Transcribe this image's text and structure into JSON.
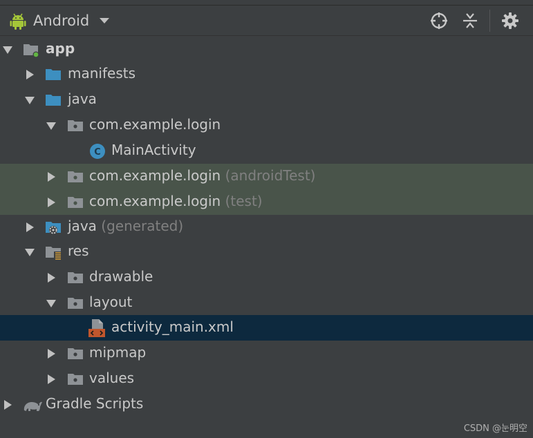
{
  "toolbar": {
    "view_label": "Android",
    "buttons": [
      {
        "name": "locate-icon"
      },
      {
        "name": "collapse-all-icon"
      },
      {
        "name": "gear-icon"
      }
    ]
  },
  "tree": {
    "rows": [
      {
        "text": "app",
        "extra": "",
        "bold": true,
        "expanded": true,
        "icon": "module-folder-icon"
      },
      {
        "text": "manifests",
        "extra": "",
        "expanded": false,
        "icon": "folder-icon"
      },
      {
        "text": "java",
        "extra": "",
        "expanded": true,
        "icon": "folder-icon"
      },
      {
        "text": "com.example.login",
        "extra": "",
        "expanded": true,
        "icon": "package-icon"
      },
      {
        "text": "MainActivity",
        "extra": "",
        "icon": "class-icon"
      },
      {
        "text": "com.example.login",
        "extra": "(androidTest)",
        "expanded": false,
        "icon": "package-icon"
      },
      {
        "text": "com.example.login",
        "extra": "(test)",
        "expanded": false,
        "icon": "package-icon"
      },
      {
        "text": "java",
        "extra": "(generated)",
        "expanded": false,
        "icon": "generated-folder-icon"
      },
      {
        "text": "res",
        "extra": "",
        "expanded": true,
        "icon": "resources-folder-icon"
      },
      {
        "text": "drawable",
        "extra": "",
        "expanded": false,
        "icon": "package-icon"
      },
      {
        "text": "layout",
        "extra": "",
        "expanded": true,
        "icon": "package-icon"
      },
      {
        "text": "activity_main.xml",
        "extra": "",
        "icon": "layout-xml-icon"
      },
      {
        "text": "mipmap",
        "extra": "",
        "expanded": false,
        "icon": "package-icon"
      },
      {
        "text": "values",
        "extra": "",
        "expanded": false,
        "icon": "package-icon"
      },
      {
        "text": "Gradle Scripts",
        "extra": "",
        "expanded": false,
        "icon": "gradle-icon"
      }
    ]
  },
  "watermark": "CSDN @눈明空",
  "colors": {
    "background": "#3c3f41",
    "highlight": "#49544a",
    "selected": "#0d293e",
    "folder_blue": "#3d8fc0",
    "android_green": "#a4c639"
  }
}
